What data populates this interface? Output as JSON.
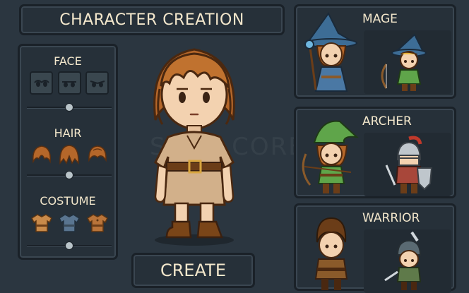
{
  "title": "CHARACTER CREATION",
  "watermark": "SAMP CORE",
  "sections": {
    "face": {
      "label": "FACE",
      "options": [
        "face-option-1",
        "face-option-2",
        "face-option-3"
      ],
      "slider_position": 0.5
    },
    "hair": {
      "label": "HAIR",
      "options": [
        "hair-option-1",
        "hair-option-2",
        "hair-option-3"
      ],
      "slider_position": 0.5
    },
    "costume": {
      "label": "COSTUME",
      "options": [
        "costume-option-1",
        "costume-option-2",
        "costume-option-3"
      ],
      "slider_position": 0.5
    }
  },
  "create_button": {
    "label": "CREATE"
  },
  "classes": [
    {
      "name": "MAGE",
      "main": "mage",
      "alt": "ranger"
    },
    {
      "name": "ARCHER",
      "main": "archer",
      "alt": "knight"
    },
    {
      "name": "WARRIOR",
      "main": "warrior",
      "alt": "soldier"
    }
  ],
  "colors": {
    "background": "#2b3640",
    "panel": "#263039",
    "border": "#1a2128",
    "text": "#f3e7cc"
  }
}
